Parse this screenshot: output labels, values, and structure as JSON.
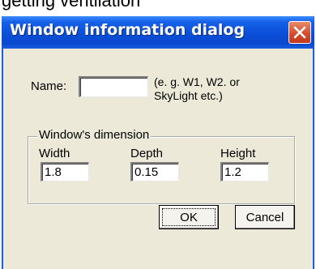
{
  "background": {
    "partial_text": "getting ventilation"
  },
  "dialog": {
    "title": "Window information dialog",
    "close_icon": "close-icon",
    "name_label": "Name:",
    "name_value": "",
    "name_hint": [
      "(e. g. W1, W2. or",
      "SkyLight etc.)"
    ],
    "dimension_group": {
      "legend": "Window's dimension",
      "width_label": "Width",
      "depth_label": "Depth",
      "height_label": "Height",
      "width_value": "1.8",
      "depth_value": "0.15",
      "height_value": "1.2"
    },
    "ok_label": "OK",
    "cancel_label": "Cancel"
  },
  "colors": {
    "titlebar": "#0a4fd8",
    "dialog_bg": "#ece9d8",
    "close_button": "#d4492a"
  }
}
